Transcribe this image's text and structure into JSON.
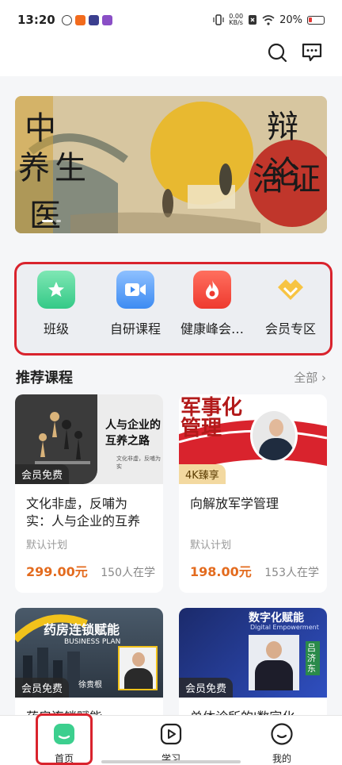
{
  "status_bar": {
    "time": "13:20",
    "net_speed_value": "0.00",
    "net_speed_unit": "KB/s",
    "battery": "20%"
  },
  "banner": {
    "text_left_top": "中",
    "text_left_mid": "养生",
    "text_left_bottom": "医",
    "text_right_top": "辩论",
    "text_right_bottom": "治证"
  },
  "quick_entries": [
    {
      "label": "班级",
      "icon": "class-star-icon",
      "color": "#3ccf8e"
    },
    {
      "label": "自研课程",
      "icon": "video-camera-icon",
      "color": "#3d8bf2"
    },
    {
      "label": "健康峰会…",
      "icon": "flame-icon",
      "color": "#f0433a"
    },
    {
      "label": "会员专区",
      "icon": "member-badge-icon",
      "color": "#f5b730"
    }
  ],
  "section": {
    "title": "推荐课程",
    "more": "全部",
    "more_icon": "chevron-right-icon"
  },
  "courses": [
    {
      "thumb_heading_1": "人与企业的",
      "thumb_heading_2": "互养之路",
      "thumb_sub": "文化非虚，反哺为实",
      "badge": "会员免费",
      "title": "文化非虚，反哺为实：人与企业的互养之路",
      "plan": "默认计划",
      "price": "299.00元",
      "learners": "150人在学"
    },
    {
      "thumb_heading": "军事化管理",
      "badge": "4K臻享",
      "title": "向解放军学管理",
      "plan": "默认计划",
      "price": "198.00元",
      "learners": "153人在学"
    },
    {
      "thumb_heading": "药房连锁赋能",
      "thumb_sub": "BUSINESS PLAN",
      "thumb_name": "徐贵根",
      "badge": "会员免费",
      "title": "药房连锁赋能"
    },
    {
      "thumb_heading": "数字化赋能",
      "thumb_sub": "Digital Empowerment",
      "thumb_name": "吕济东",
      "badge": "会员免费",
      "title": "单体诊所的'数字化"
    }
  ],
  "bottom_nav": [
    {
      "label": "首页",
      "icon": "home-icon",
      "active": true
    },
    {
      "label": "学习",
      "icon": "play-icon",
      "active": false
    },
    {
      "label": "我的",
      "icon": "profile-smile-icon",
      "active": false
    }
  ],
  "colors": {
    "accent_green": "#3ccf8e",
    "price_orange": "#e36b1e",
    "highlight_red": "#d9232d"
  }
}
